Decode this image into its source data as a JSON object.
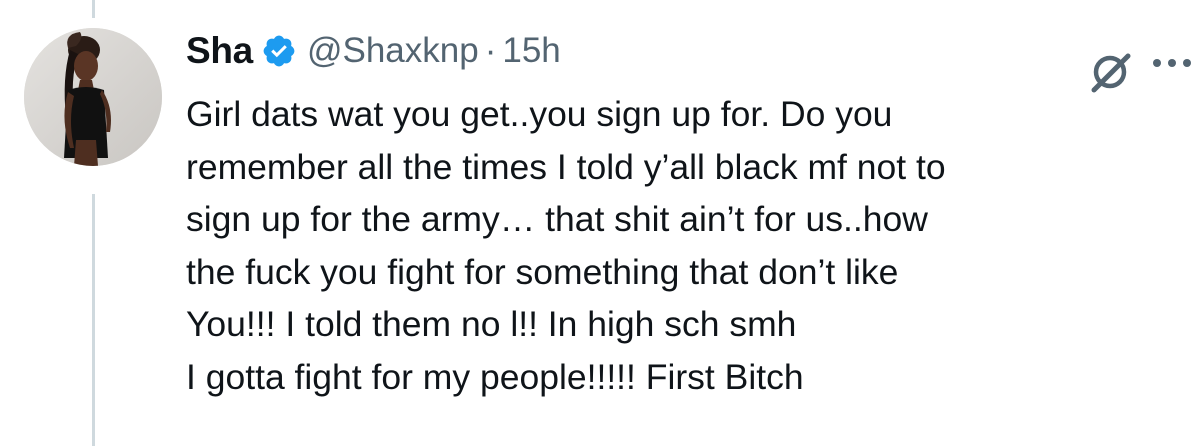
{
  "tweet": {
    "display_name": "Sha",
    "handle": "@Shaxknp",
    "separator": "·",
    "timestamp": "15h",
    "text": "Girl dats wat you get..you sign up for. Do you\nremember all the times I told y’all black mf not to\nsign up for the army… that shit ain’t for us..how\nthe fuck you fight for something that don’t like\nYou!!! I told them no l!! In high sch smh\nI gotta fight for my people!!!!! First Bitch"
  },
  "icons": {
    "verified": "verified-badge-icon",
    "grok": "grok-icon",
    "more": "more-options-icon"
  },
  "colors": {
    "text": "#0f1419",
    "secondary_text": "#536471",
    "verified_blue": "#1d9bf0",
    "thread_line": "#cfd9de"
  }
}
